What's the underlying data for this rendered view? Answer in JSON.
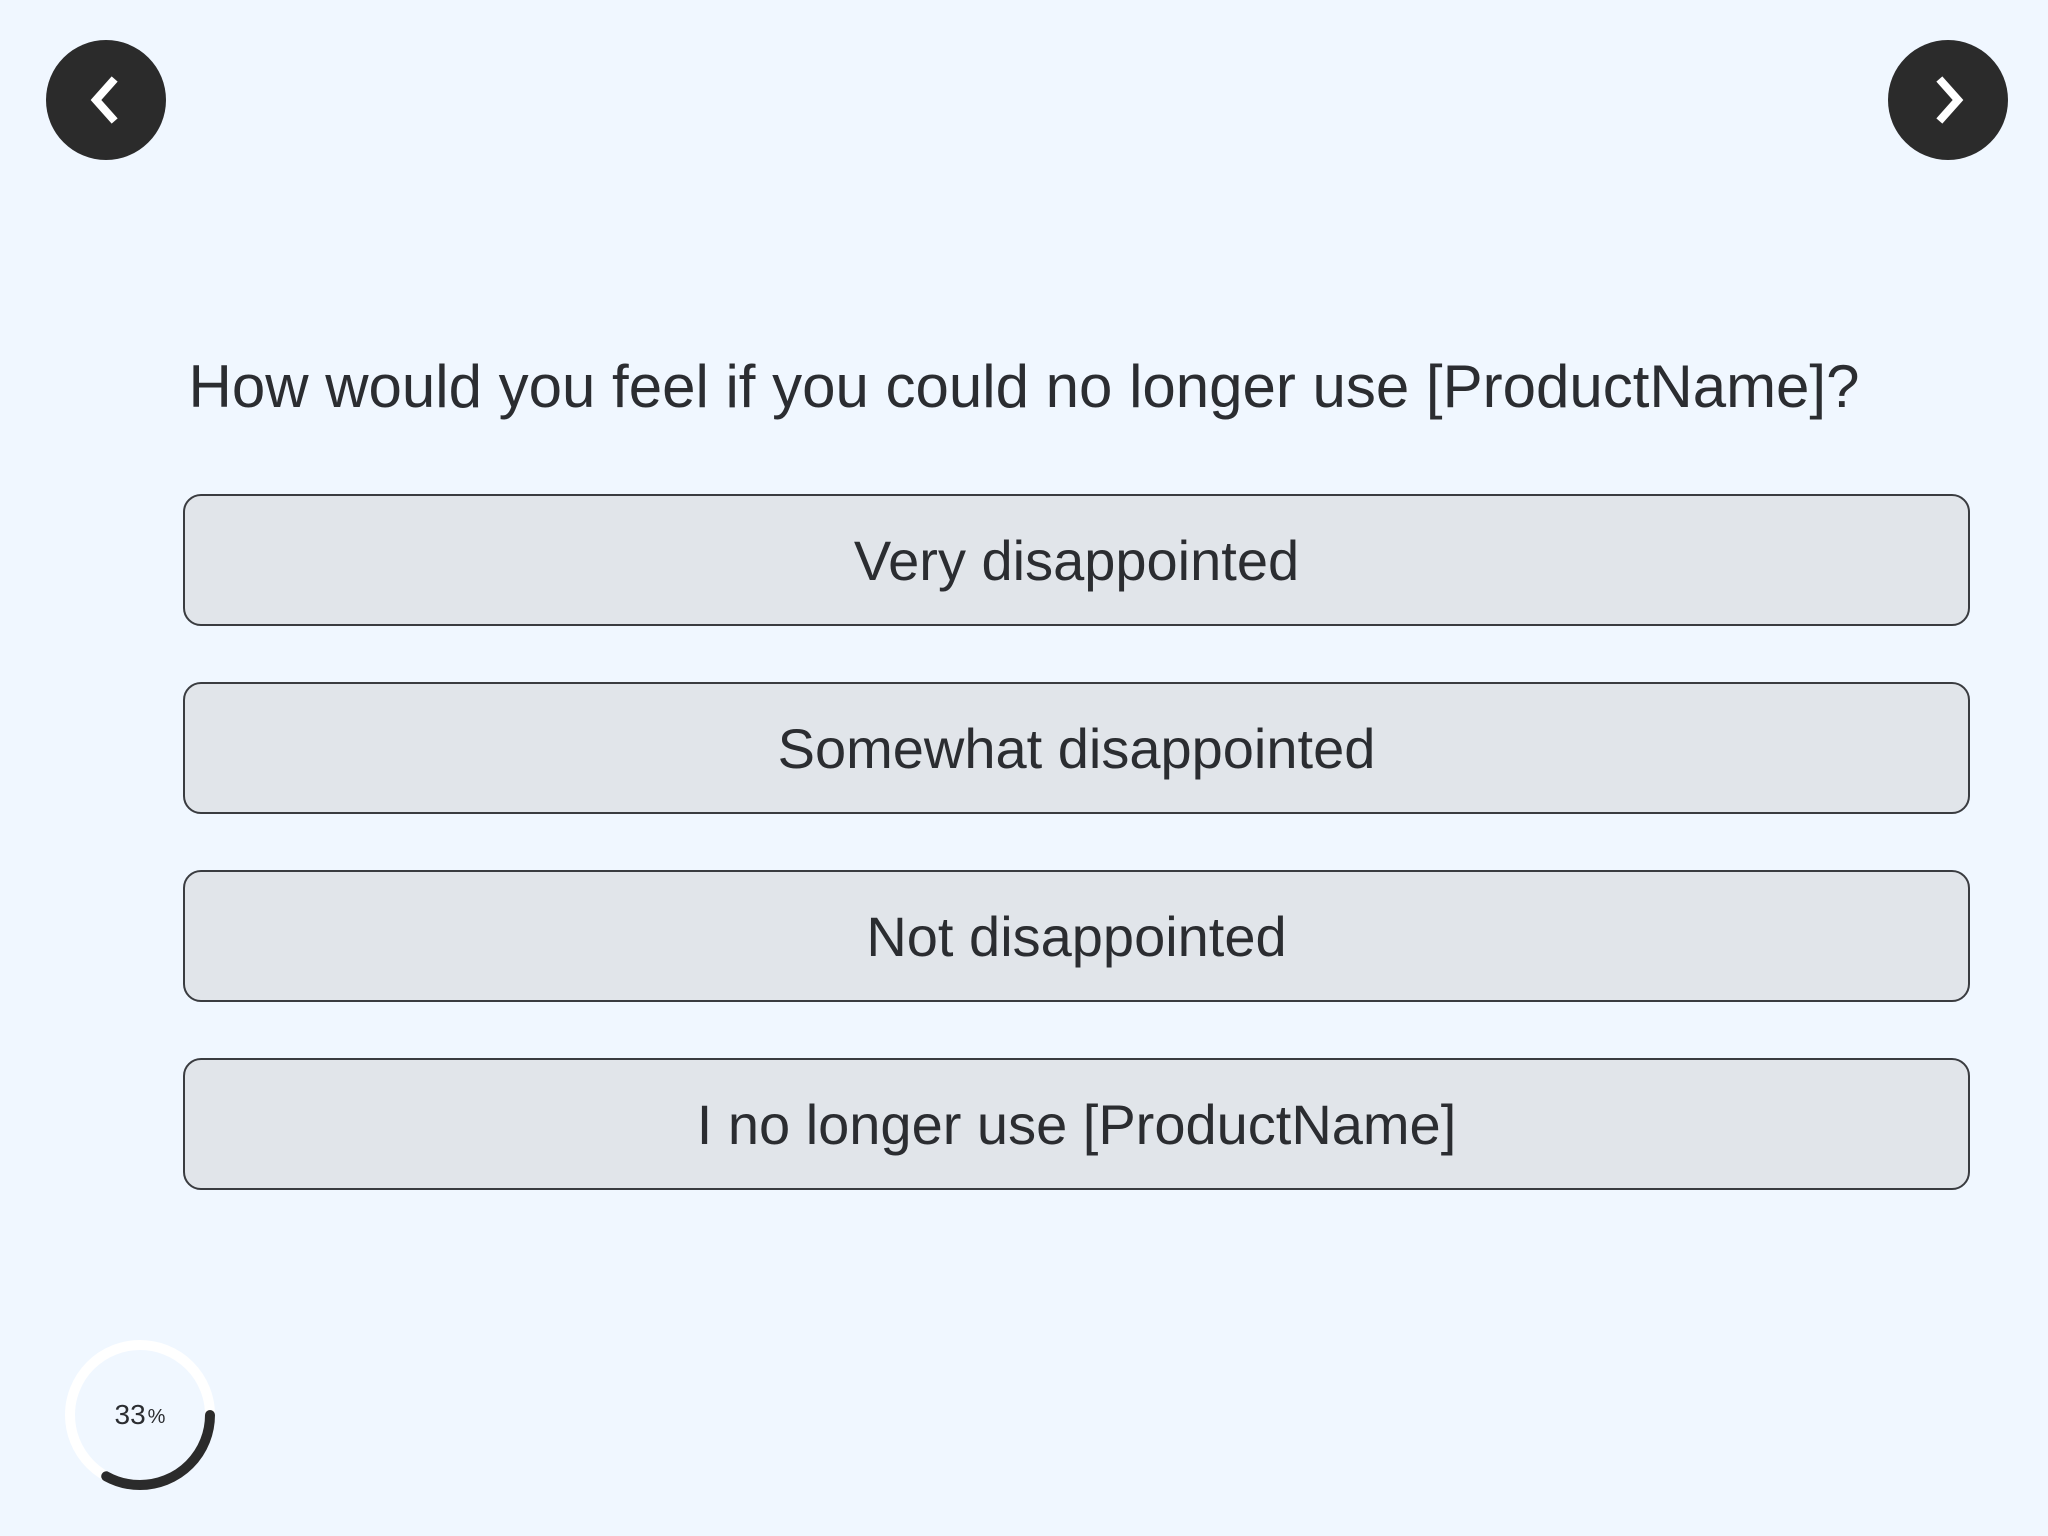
{
  "navigation": {
    "prev_icon": "chevron-left-icon",
    "next_icon": "chevron-right-icon"
  },
  "survey": {
    "question": "How would you feel if you could no longer use [ProductName]?",
    "options": [
      {
        "label": "Very disappointed"
      },
      {
        "label": "Somewhat disappointed"
      },
      {
        "label": "Not disappointed"
      },
      {
        "label": "I no longer use [ProductName]"
      }
    ]
  },
  "progress": {
    "value": "33",
    "percent_sign": "%",
    "fraction": 0.33
  },
  "colors": {
    "background": "#f0f7ff",
    "nav_button": "#2b2b2b",
    "option_fill": "#e1e5ea",
    "option_border": "#3a3c40",
    "text": "#2b2d31",
    "progress_track": "#ffffff",
    "progress_fill": "#2b2b2b"
  }
}
